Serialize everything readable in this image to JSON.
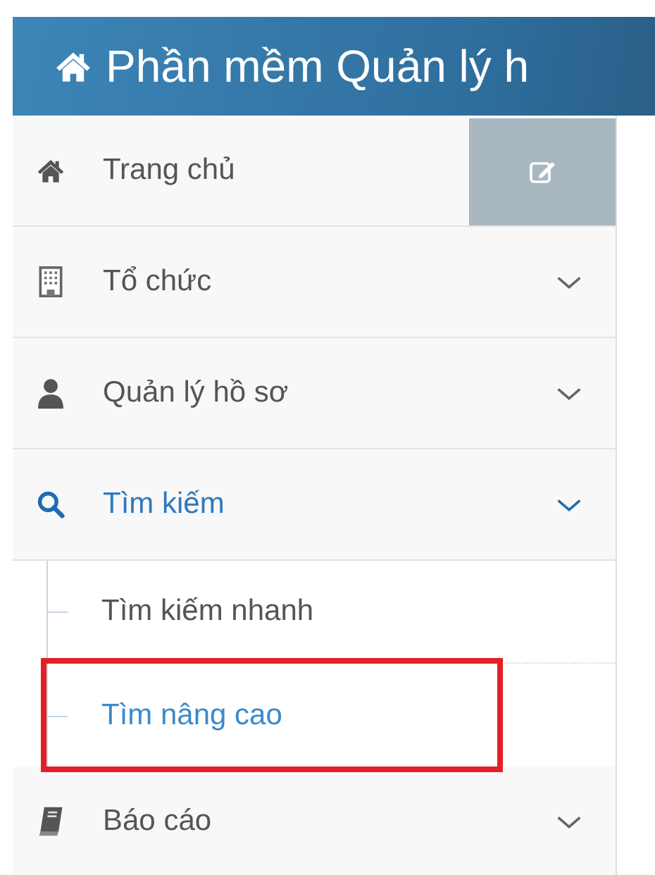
{
  "header": {
    "title": "Phần mềm Quản lý h"
  },
  "menu": [
    {
      "label": "Trang chủ",
      "kind": "link",
      "selected": false
    },
    {
      "label": "Tổ chức",
      "kind": "group",
      "selected": false
    },
    {
      "label": "Quản lý hồ sơ",
      "kind": "group",
      "selected": false
    },
    {
      "label": "Tìm kiếm",
      "kind": "group",
      "selected": true,
      "children": [
        {
          "label": "Tìm kiếm nhanh",
          "selected": false,
          "highlighted": false
        },
        {
          "label": "Tìm nâng cao",
          "selected": true,
          "highlighted": true
        }
      ]
    },
    {
      "label": "Báo cáo",
      "kind": "group",
      "selected": false
    }
  ]
}
